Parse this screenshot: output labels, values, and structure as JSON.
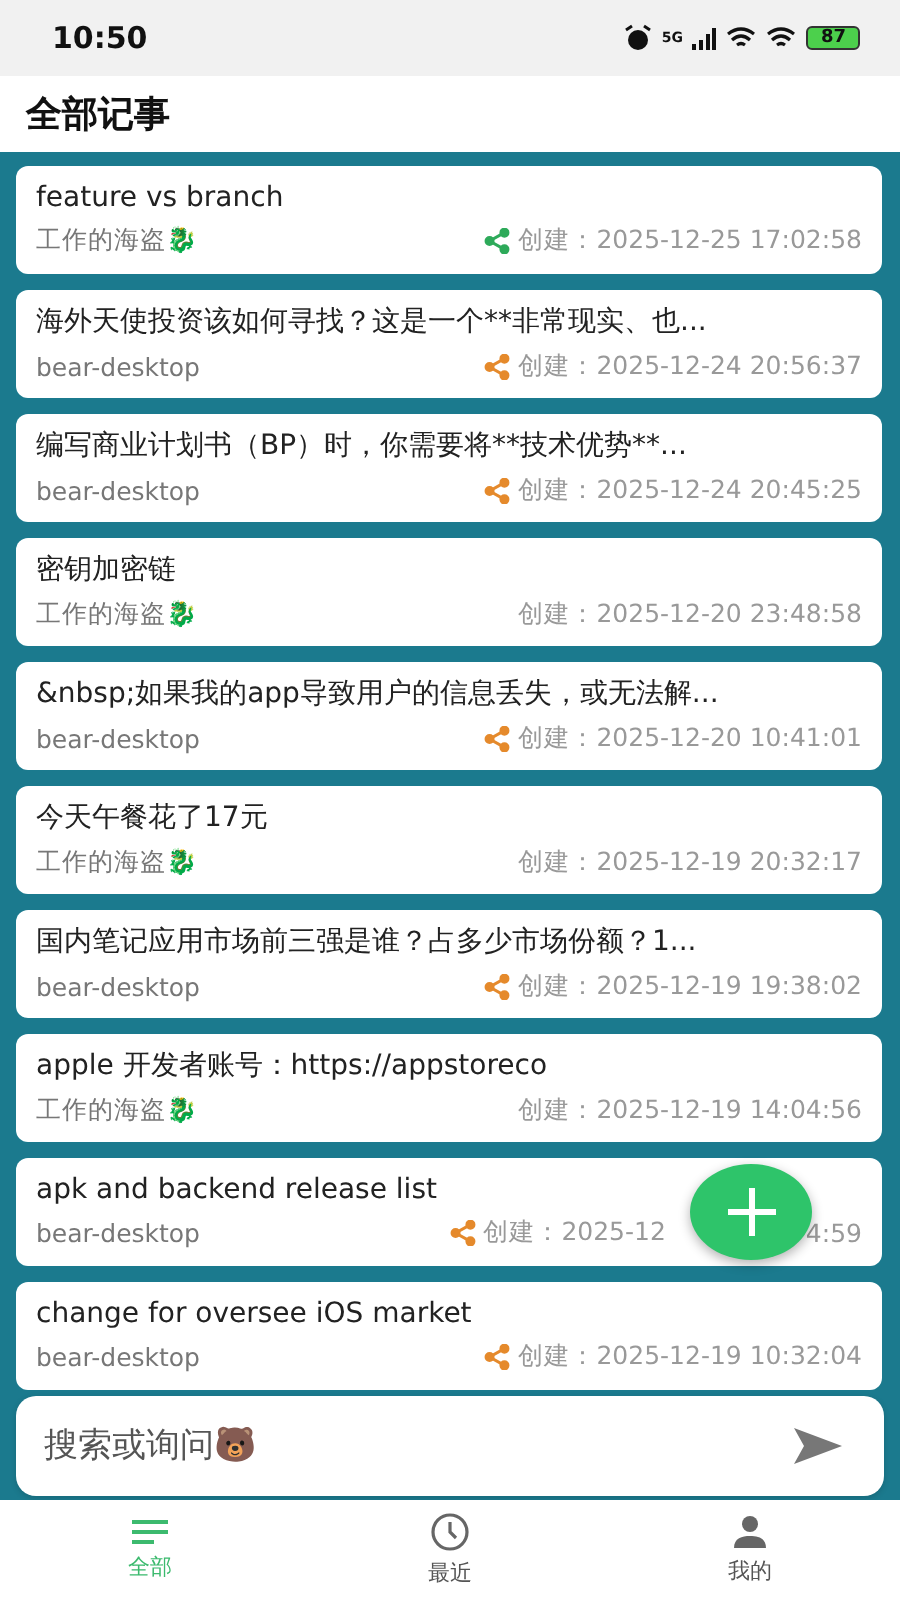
{
  "status_bar": {
    "time": "10:50",
    "network": "5G",
    "battery": "87"
  },
  "header": {
    "title": "全部记事"
  },
  "notes": [
    {
      "title": "feature vs branch",
      "source": "工作的海盗🐉",
      "shared": true,
      "color": "#2eaa5a",
      "created": "创建：2025-12-25 17:02:58"
    },
    {
      "title": "海外天使投资该如何寻找？这是一个**非常现实、也...",
      "source": "bear-desktop",
      "shared": true,
      "color": "#e58a2c",
      "created": "创建：2025-12-24 20:56:37"
    },
    {
      "title": "编写商业计划书（BP）时，你需要将**技术优势**...",
      "source": "bear-desktop",
      "shared": true,
      "color": "#e58a2c",
      "created": "创建：2025-12-24 20:45:25"
    },
    {
      "title": "密钥加密链",
      "source": "工作的海盗🐉",
      "shared": false,
      "created": "创建：2025-12-20 23:48:58"
    },
    {
      "title": "&nbsp;如果我的app导致用户的信息丢失，或无法解...",
      "source": "bear-desktop",
      "shared": true,
      "color": "#e58a2c",
      "created": "创建：2025-12-20 10:41:01"
    },
    {
      "title": "今天午餐花了17元",
      "source": "工作的海盗🐉",
      "shared": false,
      "created": "创建：2025-12-19 20:32:17"
    },
    {
      "title": "国内笔记应用市场前三强是谁？占多少市场份额？1...",
      "source": "bear-desktop",
      "shared": true,
      "color": "#e58a2c",
      "created": "创建：2025-12-19 19:38:02"
    },
    {
      "title": "apple 开发者账号：https://appstoreco",
      "source": "工作的海盗🐉",
      "shared": false,
      "created": "创建：2025-12-19 14:04:56"
    },
    {
      "title": "apk and backend release list",
      "source": "bear-desktop",
      "shared": true,
      "color": "#e58a2c",
      "created": "创建：2025-12",
      "created_end": "4:59"
    },
    {
      "title": "change for oversee iOS market",
      "source": "bear-desktop",
      "shared": true,
      "color": "#e58a2c",
      "created": "创建：2025-12-19 10:32:04"
    }
  ],
  "search": {
    "placeholder": "搜索或询问🐻"
  },
  "tabs": [
    {
      "label": "全部",
      "kind": "list",
      "selected": true
    },
    {
      "label": "最近",
      "kind": "clock",
      "selected": false
    },
    {
      "label": "我的",
      "kind": "person",
      "selected": false
    }
  ]
}
